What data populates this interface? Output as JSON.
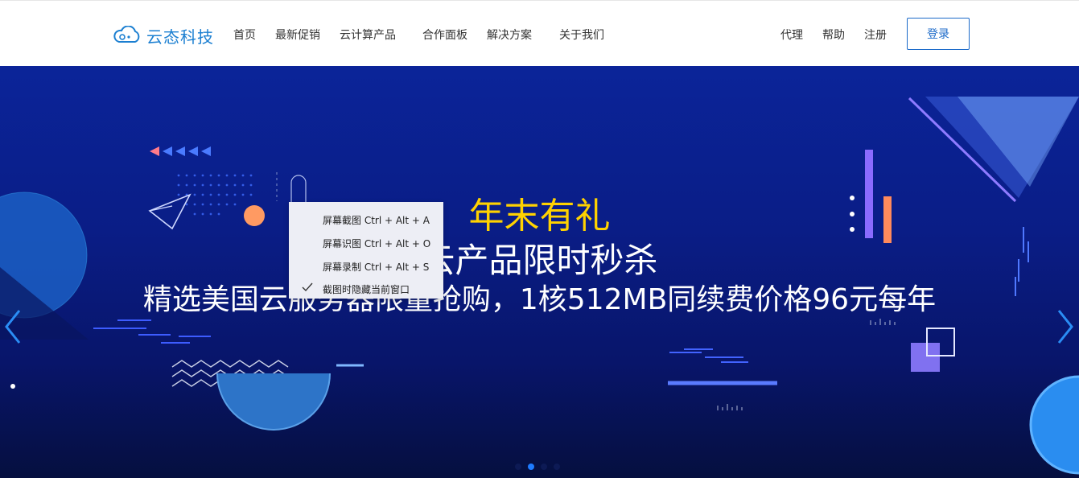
{
  "header": {
    "logo_text": "云态科技",
    "nav": [
      "首页",
      "最新促销",
      "云计算产品",
      "合作面板",
      "解决方案",
      "关于我们"
    ],
    "right_links": [
      "代理",
      "帮助",
      "注册"
    ],
    "login_label": "登录"
  },
  "banner": {
    "title": "年末有礼",
    "subtitle": "云产品限时秒杀",
    "description": "精选美国云服务器限量抢购，1核512MB同续费价格96元每年",
    "slide_count": 4,
    "active_slide": 2
  },
  "context_menu": {
    "items": [
      "屏幕截图 Ctrl + Alt + A",
      "屏幕识图 Ctrl + Alt + O",
      "屏幕录制 Ctrl + Alt + S",
      "截图时隐藏当前窗口"
    ],
    "checked_item": "截图时隐藏当前窗口"
  },
  "colors": {
    "brand": "#1b7fd1",
    "title_yellow": "#ffd200",
    "banner_bg": "#0b2499"
  }
}
